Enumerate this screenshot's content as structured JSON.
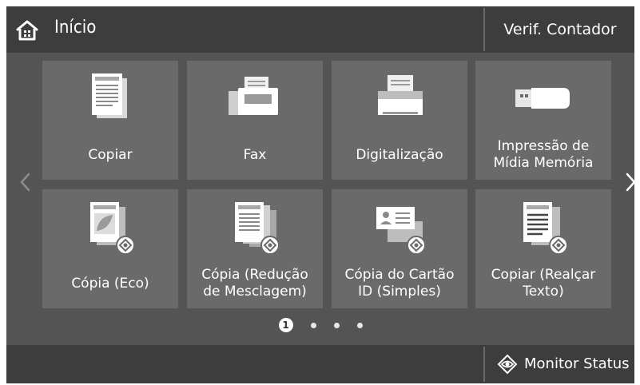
{
  "header": {
    "title": "Início",
    "icon": "home-icon",
    "counter_button": "Verif. Contador"
  },
  "tiles": [
    {
      "label": "Copiar",
      "icon": "copy-icon"
    },
    {
      "label": "Fax",
      "icon": "fax-icon"
    },
    {
      "label": "Digitalização",
      "icon": "scanner-icon"
    },
    {
      "label": "Impressão de\nMídia Memória",
      "icon": "usb-memory-icon"
    },
    {
      "label": "Cópia (Eco)",
      "icon": "eco-copy-icon"
    },
    {
      "label": "Cópia (Redução\nde Mesclagem)",
      "icon": "merge-copy-icon"
    },
    {
      "label": "Cópia do Cartão\nID (Simples)",
      "icon": "id-card-copy-icon"
    },
    {
      "label": "Copiar (Realçar\nTexto)",
      "icon": "text-enhance-copy-icon"
    }
  ],
  "pager": {
    "current_page": "1",
    "total_pages": 4
  },
  "footer": {
    "monitor_button": "Monitor Status",
    "monitor_icon": "monitor-status-icon"
  }
}
